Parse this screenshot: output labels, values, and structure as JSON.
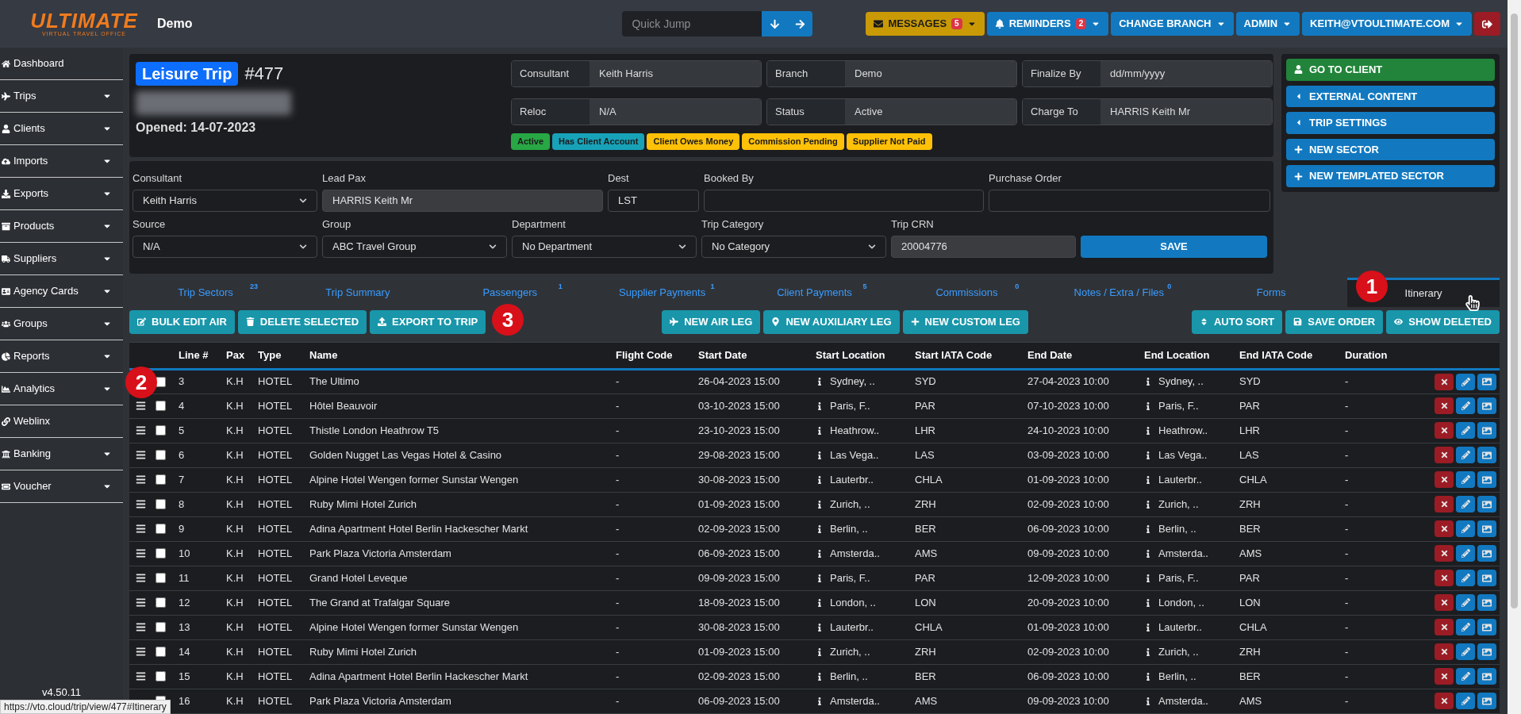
{
  "topbar": {
    "logo_title": "ULTIMATE",
    "logo_subtitle": "VIRTUAL TRAVEL OFFICE",
    "branch": "Demo",
    "quick_jump": {
      "placeholder": "Quick Jump"
    },
    "buttons": [
      {
        "label": "MESSAGES",
        "badge": "5",
        "kind": "warning",
        "caret": true
      },
      {
        "label": "REMINDERS",
        "badge": "2",
        "kind": "primary",
        "caret": true
      },
      {
        "label": "CHANGE BRANCH",
        "kind": "primary",
        "caret": true
      },
      {
        "label": "ADMIN",
        "kind": "primary",
        "caret": true
      },
      {
        "label": "KEITH@VTOULTIMATE.COM",
        "kind": "primary",
        "caret": true
      },
      {
        "kind": "danger",
        "caret": false
      }
    ]
  },
  "sidebar": {
    "items": [
      {
        "label": "Dashboard",
        "has_menu": false
      },
      {
        "label": "Trips",
        "has_menu": true
      },
      {
        "label": "Clients",
        "has_menu": true
      },
      {
        "label": "Imports",
        "has_menu": true
      },
      {
        "label": "Exports",
        "has_menu": true
      },
      {
        "label": "Products",
        "has_menu": true
      },
      {
        "label": "Suppliers",
        "has_menu": true
      },
      {
        "label": "Agency Cards",
        "has_menu": true
      },
      {
        "label": "Groups",
        "has_menu": true
      },
      {
        "label": "Reports",
        "has_menu": true
      },
      {
        "label": "Analytics",
        "has_menu": true
      },
      {
        "label": "Weblinx",
        "has_menu": false
      },
      {
        "label": "Banking",
        "has_menu": true
      },
      {
        "label": "Voucher",
        "has_menu": true
      }
    ],
    "version": "v4.50.11"
  },
  "trip": {
    "type": "Leisure Trip",
    "number": "#477",
    "opened": "Opened: 14-07-2023",
    "info": [
      {
        "label": "Consultant",
        "value": "Keith Harris"
      },
      {
        "label": "Branch",
        "value": "Demo"
      },
      {
        "label": "Finalize By",
        "placeholder": "dd/mm/yyyy"
      },
      {
        "label": "Reloc",
        "value": "N/A"
      },
      {
        "label": "Status",
        "value": "Active"
      },
      {
        "label": "Charge To",
        "value": "HARRIS Keith Mr"
      }
    ],
    "badges": [
      {
        "label": "Active",
        "color": "#28a745"
      },
      {
        "label": "Has Client Account",
        "color": "#17a2b8"
      },
      {
        "label": "Client Owes Money",
        "color": "#ffc107"
      },
      {
        "label": "Commission Pending",
        "color": "#ffc107"
      },
      {
        "label": "Supplier Not Paid",
        "color": "#ffc107"
      }
    ]
  },
  "side_actions": [
    {
      "label": "GO TO CLIENT",
      "kind": "success"
    },
    {
      "label": "EXTERNAL CONTENT",
      "kind": "primary"
    },
    {
      "label": "TRIP SETTINGS",
      "kind": "primary"
    },
    {
      "label": "NEW SECTOR",
      "kind": "primary"
    },
    {
      "label": "NEW TEMPLATED SECTOR",
      "kind": "primary"
    }
  ],
  "form": {
    "rows": [
      [
        {
          "label": "Consultant",
          "kind": "select",
          "value": "Keith Harris"
        },
        {
          "label": "Lead Pax",
          "kind": "readonly",
          "value": "HARRIS Keith Mr"
        },
        {
          "label": "Dest",
          "kind": "input",
          "value": "LST"
        },
        {
          "label": "Booked By",
          "kind": "input"
        },
        {
          "label": "Purchase Order",
          "kind": "input"
        }
      ],
      [
        {
          "label": "Source",
          "kind": "select",
          "value": "N/A"
        },
        {
          "label": "Group",
          "kind": "select",
          "value": "ABC Travel Group"
        },
        {
          "label": "Department",
          "kind": "select",
          "value": "No Department"
        },
        {
          "label": "Trip Category",
          "kind": "select",
          "value": "No Category"
        },
        {
          "label": "Trip CRN",
          "kind": "readonly",
          "value": "20004776"
        }
      ]
    ],
    "save": "SAVE"
  },
  "tabs": [
    {
      "label": "Trip Sectors",
      "count": "23",
      "selected": false
    },
    {
      "label": "Trip Summary",
      "selected": false
    },
    {
      "label": "Passengers",
      "count": "1",
      "selected": false
    },
    {
      "label": "Supplier Payments",
      "count": "1",
      "selected": false
    },
    {
      "label": "Client Payments",
      "count": "5",
      "selected": false
    },
    {
      "label": "Commissions",
      "count": "0",
      "selected": false
    },
    {
      "label": "Notes / Extra / Files",
      "count": "0",
      "selected": false
    },
    {
      "label": "Forms",
      "selected": false
    },
    {
      "label": "Itinerary",
      "selected": true
    }
  ],
  "toolbar": {
    "left": [
      "BULK EDIT AIR",
      "DELETE SELECTED",
      "EXPORT TO TRIP"
    ],
    "center": [
      "NEW AIR LEG",
      "NEW AUXILIARY LEG",
      "NEW CUSTOM LEG"
    ],
    "right": [
      "AUTO SORT",
      "SAVE ORDER",
      "SHOW DELETED"
    ]
  },
  "table": {
    "columns": [
      "Line #",
      "Pax",
      "Type",
      "Name",
      "Flight Code",
      "Start Date",
      "Start Location",
      "Start IATA Code",
      "End Date",
      "End Location",
      "End IATA Code",
      "Duration"
    ],
    "rows": [
      {
        "line": "3",
        "pax": "K.H",
        "type": "HOTEL",
        "name": "The Ultimo",
        "flight_code": "-",
        "start_date": "26-04-2023 15:00",
        "start_location": "Sydney, ..",
        "start_iata": "SYD",
        "end_date": "27-04-2023 10:00",
        "end_location": "Sydney, ..",
        "end_iata": "SYD",
        "duration": "-",
        "checked": false,
        "drag_handle": false
      },
      {
        "line": "4",
        "pax": "K.H",
        "type": "HOTEL",
        "name": "Hôtel Beauvoir",
        "flight_code": "-",
        "start_date": "03-10-2023 15:00",
        "start_location": "Paris, F..",
        "start_iata": "PAR",
        "end_date": "07-10-2023 10:00",
        "end_location": "Paris, F..",
        "end_iata": "PAR",
        "duration": "-",
        "checked": false,
        "drag_handle": true
      },
      {
        "line": "5",
        "pax": "K.H",
        "type": "HOTEL",
        "name": "Thistle London Heathrow T5",
        "flight_code": "-",
        "start_date": "23-10-2023 15:00",
        "start_location": "Heathrow..",
        "start_iata": "LHR",
        "end_date": "24-10-2023 10:00",
        "end_location": "Heathrow..",
        "end_iata": "LHR",
        "duration": "-",
        "checked": false,
        "drag_handle": true
      },
      {
        "line": "6",
        "pax": "K.H",
        "type": "HOTEL",
        "name": "Golden Nugget Las Vegas Hotel & Casino",
        "flight_code": "-",
        "start_date": "29-08-2023 15:00",
        "start_location": "Las Vega..",
        "start_iata": "LAS",
        "end_date": "03-09-2023 10:00",
        "end_location": "Las Vega..",
        "end_iata": "LAS",
        "duration": "-",
        "checked": false,
        "drag_handle": true
      },
      {
        "line": "7",
        "pax": "K.H",
        "type": "HOTEL",
        "name": "Alpine Hotel Wengen former Sunstar Wengen",
        "flight_code": "-",
        "start_date": "30-08-2023 15:00",
        "start_location": "Lauterbr..",
        "start_iata": "CHLA",
        "end_date": "01-09-2023 10:00",
        "end_location": "Lauterbr..",
        "end_iata": "CHLA",
        "duration": "-",
        "checked": false,
        "drag_handle": true
      },
      {
        "line": "8",
        "pax": "K.H",
        "type": "HOTEL",
        "name": "Ruby Mimi Hotel Zurich",
        "flight_code": "-",
        "start_date": "01-09-2023 15:00",
        "start_location": "Zurich, ..",
        "start_iata": "ZRH",
        "end_date": "02-09-2023 10:00",
        "end_location": "Zurich, ..",
        "end_iata": "ZRH",
        "duration": "-",
        "checked": false,
        "drag_handle": true
      },
      {
        "line": "9",
        "pax": "K.H",
        "type": "HOTEL",
        "name": "Adina Apartment Hotel Berlin Hackescher Markt",
        "flight_code": "-",
        "start_date": "02-09-2023 15:00",
        "start_location": "Berlin, ..",
        "start_iata": "BER",
        "end_date": "06-09-2023 10:00",
        "end_location": "Berlin, ..",
        "end_iata": "BER",
        "duration": "-",
        "checked": false,
        "drag_handle": true
      },
      {
        "line": "10",
        "pax": "K.H",
        "type": "HOTEL",
        "name": "Park Plaza Victoria Amsterdam",
        "flight_code": "-",
        "start_date": "06-09-2023 15:00",
        "start_location": "Amsterda..",
        "start_iata": "AMS",
        "end_date": "09-09-2023 10:00",
        "end_location": "Amsterda..",
        "end_iata": "AMS",
        "duration": "-",
        "checked": false,
        "drag_handle": true
      },
      {
        "line": "11",
        "pax": "K.H",
        "type": "HOTEL",
        "name": "Grand Hotel Leveque",
        "flight_code": "-",
        "start_date": "09-09-2023 15:00",
        "start_location": "Paris, F..",
        "start_iata": "PAR",
        "end_date": "12-09-2023 10:00",
        "end_location": "Paris, F..",
        "end_iata": "PAR",
        "duration": "-",
        "checked": false,
        "drag_handle": true
      },
      {
        "line": "12",
        "pax": "K.H",
        "type": "HOTEL",
        "name": "The Grand at Trafalgar Square",
        "flight_code": "-",
        "start_date": "18-09-2023 15:00",
        "start_location": "London, ..",
        "start_iata": "LON",
        "end_date": "20-09-2023 10:00",
        "end_location": "London, ..",
        "end_iata": "LON",
        "duration": "-",
        "checked": false,
        "drag_handle": true
      },
      {
        "line": "13",
        "pax": "K.H",
        "type": "HOTEL",
        "name": "Alpine Hotel Wengen former Sunstar Wengen",
        "flight_code": "-",
        "start_date": "30-08-2023 15:00",
        "start_location": "Lauterbr..",
        "start_iata": "CHLA",
        "end_date": "01-09-2023 10:00",
        "end_location": "Lauterbr..",
        "end_iata": "CHLA",
        "duration": "-",
        "checked": false,
        "drag_handle": true
      },
      {
        "line": "14",
        "pax": "K.H",
        "type": "HOTEL",
        "name": "Ruby Mimi Hotel Zurich",
        "flight_code": "-",
        "start_date": "01-09-2023 15:00",
        "start_location": "Zurich, ..",
        "start_iata": "ZRH",
        "end_date": "02-09-2023 10:00",
        "end_location": "Zurich, ..",
        "end_iata": "ZRH",
        "duration": "-",
        "checked": false,
        "drag_handle": true
      },
      {
        "line": "15",
        "pax": "K.H",
        "type": "HOTEL",
        "name": "Adina Apartment Hotel Berlin Hackescher Markt",
        "flight_code": "-",
        "start_date": "02-09-2023 15:00",
        "start_location": "Berlin, ..",
        "start_iata": "BER",
        "end_date": "06-09-2023 10:00",
        "end_location": "Berlin, ..",
        "end_iata": "BER",
        "duration": "-",
        "checked": false,
        "drag_handle": true
      },
      {
        "line": "16",
        "pax": "K.H",
        "type": "HOTEL",
        "name": "Park Plaza Victoria Amsterdam",
        "flight_code": "-",
        "start_date": "06-09-2023 15:00",
        "start_location": "Amsterda..",
        "start_iata": "AMS",
        "end_date": "09-09-2023 10:00",
        "end_location": "Amsterda..",
        "end_iata": "AMS",
        "duration": "-",
        "checked": false,
        "drag_handle": false
      }
    ]
  },
  "annotations": [
    "1",
    "2",
    "3"
  ],
  "status_url": "https://vto.cloud/trip/view/477#Itinerary"
}
